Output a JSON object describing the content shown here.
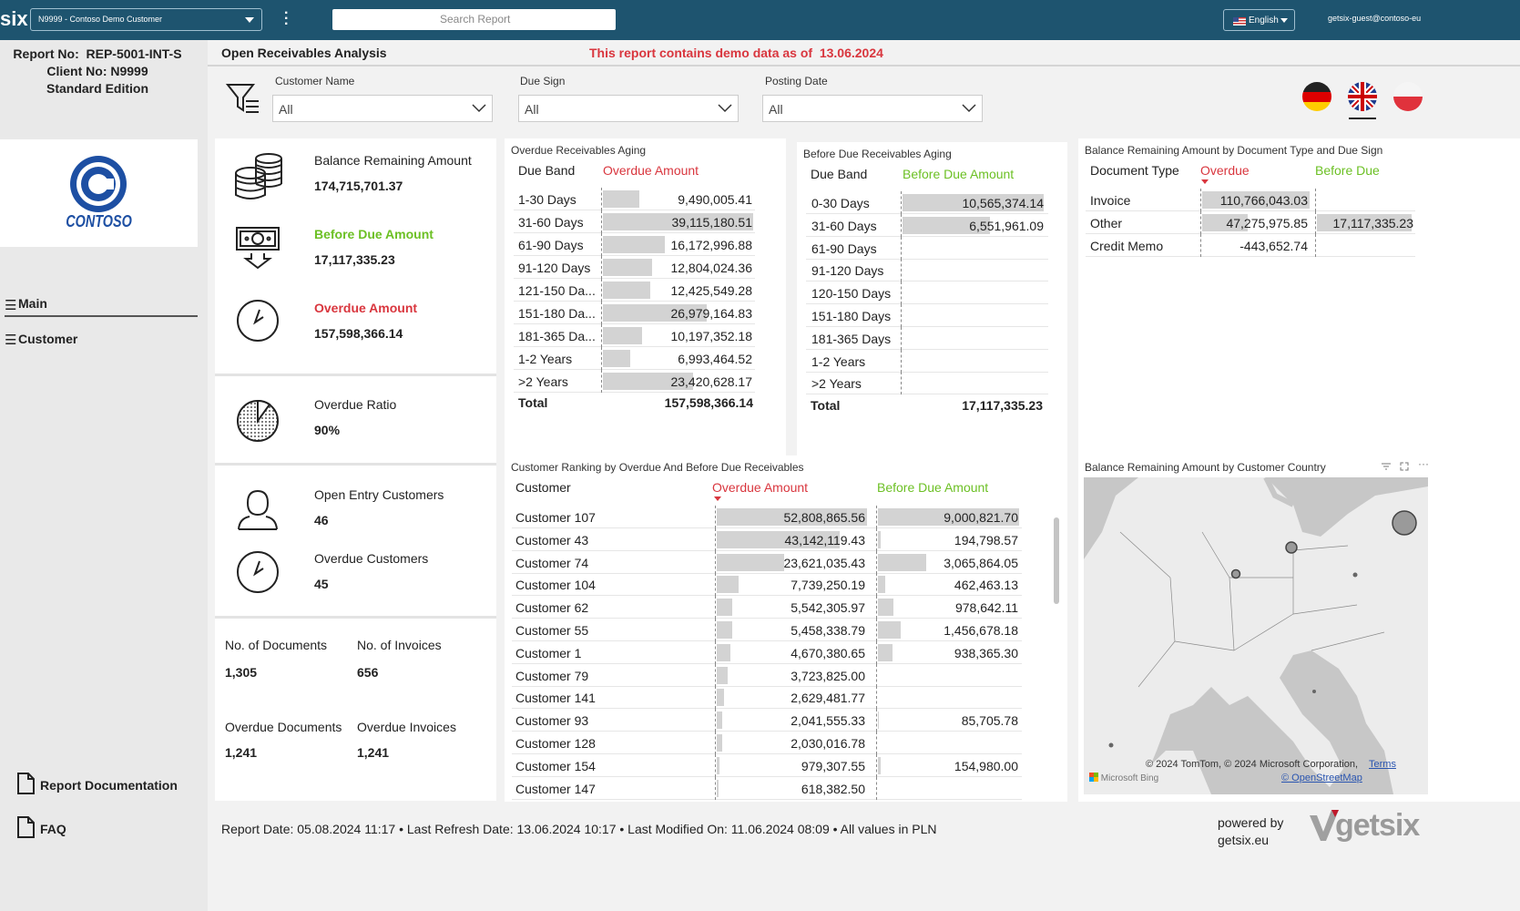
{
  "topbar": {
    "logo_text": "six",
    "customer_select": "N9999 - Contoso Demo Customer",
    "search_placeholder": "Search Report",
    "language": "English",
    "user": "getsix-guest@contoso-eu"
  },
  "sidebar": {
    "report_no": "Report No:  REP-5001-INT-S",
    "client_no": "Client No: N9999",
    "edition": "Standard Edition",
    "brand": "CONTOSO",
    "nav": [
      "Main",
      "Customer"
    ],
    "docs": "Report Documentation",
    "faq": "FAQ"
  },
  "header": {
    "title": "Open Receivables Analysis",
    "demo_notice": "This report contains demo data as of  13.06.2024"
  },
  "filters": [
    {
      "label": "Customer Name",
      "value": "All"
    },
    {
      "label": "Due Sign",
      "value": "All"
    },
    {
      "label": "Posting Date",
      "value": "All"
    }
  ],
  "kpis": {
    "balance_label": "Balance Remaining Amount",
    "balance_value": "174,715,701.37",
    "before_due_label": "Before Due Amount",
    "before_due_value": "17,117,335.23",
    "overdue_label": "Overdue Amount",
    "overdue_value": "157,598,366.14",
    "ratio_label": "Overdue Ratio",
    "ratio_value": "90%",
    "open_cust_label": "Open Entry Customers",
    "open_cust_value": "46",
    "overdue_cust_label": "Overdue Customers",
    "overdue_cust_value": "45",
    "docs_label": "No. of Documents",
    "docs_value": "1,305",
    "inv_label": "No. of Invoices",
    "inv_value": "656",
    "od_docs_label": "Overdue Documents",
    "od_docs_value": "1,241",
    "od_inv_label": "Overdue Invoices",
    "od_inv_value": "1,241"
  },
  "overdue_aging": {
    "title": "Overdue Receivables Aging",
    "col1": "Due Band",
    "col2": "Overdue Amount",
    "rows": [
      {
        "band": "1-30 Days",
        "amount": "9,490,005.41",
        "v": 9490005.41
      },
      {
        "band": "31-60 Days",
        "amount": "39,115,180.51",
        "v": 39115180.51
      },
      {
        "band": "61-90 Days",
        "amount": "16,172,996.88",
        "v": 16172996.88
      },
      {
        "band": "91-120 Days",
        "amount": "12,804,024.36",
        "v": 12804024.36
      },
      {
        "band": "121-150 Da...",
        "amount": "12,425,549.28",
        "v": 12425549.28
      },
      {
        "band": "151-180 Da...",
        "amount": "26,979,164.83",
        "v": 26979164.83
      },
      {
        "band": "181-365 Da...",
        "amount": "10,197,352.18",
        "v": 10197352.18
      },
      {
        "band": "1-2 Years",
        "amount": "6,993,464.52",
        "v": 6993464.52
      },
      {
        "band": ">2 Years",
        "amount": "23,420,628.17",
        "v": 23420628.17
      }
    ],
    "total_label": "Total",
    "total": "157,598,366.14"
  },
  "before_aging": {
    "title": "Before Due Receivables Aging",
    "col1": "Due Band",
    "col2": "Before Due Amount",
    "rows": [
      {
        "band": "0-30 Days",
        "amount": "10,565,374.14",
        "v": 10565374.14
      },
      {
        "band": "31-60 Days",
        "amount": "6,551,961.09",
        "v": 6551961.09
      },
      {
        "band": "61-90 Days",
        "amount": "",
        "v": 0
      },
      {
        "band": "91-120 Days",
        "amount": "",
        "v": 0
      },
      {
        "band": "120-150 Days",
        "amount": "",
        "v": 0
      },
      {
        "band": "151-180 Days",
        "amount": "",
        "v": 0
      },
      {
        "band": "181-365 Days",
        "amount": "",
        "v": 0
      },
      {
        "band": "1-2 Years",
        "amount": "",
        "v": 0
      },
      {
        "band": ">2 Years",
        "amount": "",
        "v": 0
      }
    ],
    "total_label": "Total",
    "total": "17,117,335.23"
  },
  "doctype": {
    "title": "Balance Remaining Amount by Document Type and Due Sign",
    "col1": "Document Type",
    "col2": "Overdue",
    "col3": "Before Due",
    "rows": [
      {
        "type": "Invoice",
        "overdue": "110,766,043.03",
        "ov": 110766043.03,
        "before": "",
        "bv": 0
      },
      {
        "type": "Other",
        "overdue": "47,275,975.85",
        "ov": 47275975.85,
        "before": "17,117,335.23",
        "bv": 17117335.23
      },
      {
        "type": "Credit Memo",
        "overdue": "-443,652.74",
        "ov": -443652.74,
        "before": "",
        "bv": 0
      }
    ]
  },
  "ranking": {
    "title": "Customer Ranking by Overdue And Before Due Receivables",
    "col1": "Customer",
    "col2": "Overdue Amount",
    "col3": "Before Due Amount",
    "rows": [
      {
        "name": "Customer 107",
        "overdue": "52,808,865.56",
        "ov": 52808865.56,
        "before": "9,000,821.70",
        "bv": 9000821.7
      },
      {
        "name": "Customer 43",
        "overdue": "43,142,119.43",
        "ov": 43142119.43,
        "before": "194,798.57",
        "bv": 194798.57
      },
      {
        "name": "Customer 74",
        "overdue": "23,621,035.43",
        "ov": 23621035.43,
        "before": "3,065,864.05",
        "bv": 3065864.05
      },
      {
        "name": "Customer 104",
        "overdue": "7,739,250.19",
        "ov": 7739250.19,
        "before": "462,463.13",
        "bv": 462463.13
      },
      {
        "name": "Customer 62",
        "overdue": "5,542,305.97",
        "ov": 5542305.97,
        "before": "978,642.11",
        "bv": 978642.11
      },
      {
        "name": "Customer 55",
        "overdue": "5,458,338.79",
        "ov": 5458338.79,
        "before": "1,456,678.18",
        "bv": 1456678.18
      },
      {
        "name": "Customer 1",
        "overdue": "4,670,380.65",
        "ov": 4670380.65,
        "before": "938,365.30",
        "bv": 938365.3
      },
      {
        "name": "Customer 79",
        "overdue": "3,723,825.00",
        "ov": 3723825.0,
        "before": "",
        "bv": 0
      },
      {
        "name": "Customer 141",
        "overdue": "2,629,481.77",
        "ov": 2629481.77,
        "before": "",
        "bv": 0
      },
      {
        "name": "Customer 93",
        "overdue": "2,041,555.33",
        "ov": 2041555.33,
        "before": "85,705.78",
        "bv": 85705.78
      },
      {
        "name": "Customer 128",
        "overdue": "2,030,016.78",
        "ov": 2030016.78,
        "before": "",
        "bv": 0
      },
      {
        "name": "Customer 154",
        "overdue": "979,307.55",
        "ov": 979307.55,
        "before": "154,980.00",
        "bv": 154980.0
      },
      {
        "name": "Customer 147",
        "overdue": "618,382.50",
        "ov": 618382.5,
        "before": "",
        "bv": 0
      }
    ]
  },
  "map": {
    "title": "Balance Remaining Amount by Customer Country",
    "attribution": "© 2024 TomTom, © 2024 Microsoft Corporation,",
    "terms": "Terms",
    "osm": "© OpenStreetMap",
    "bing": "Microsoft Bing"
  },
  "footer": {
    "text": "Report Date: 05.08.2024 11:17 • Last Refresh Date: 13.06.2024 10:17 • Last Modified On: 11.06.2024 08:09 • All values in PLN",
    "powered": "powered by",
    "site": "getsix.eu",
    "brand": "getsix"
  },
  "colors": {
    "topbar": "#1e546f",
    "overdue": "#d9363e",
    "before_due": "#6cc024",
    "bar": "#d3d3d3"
  }
}
